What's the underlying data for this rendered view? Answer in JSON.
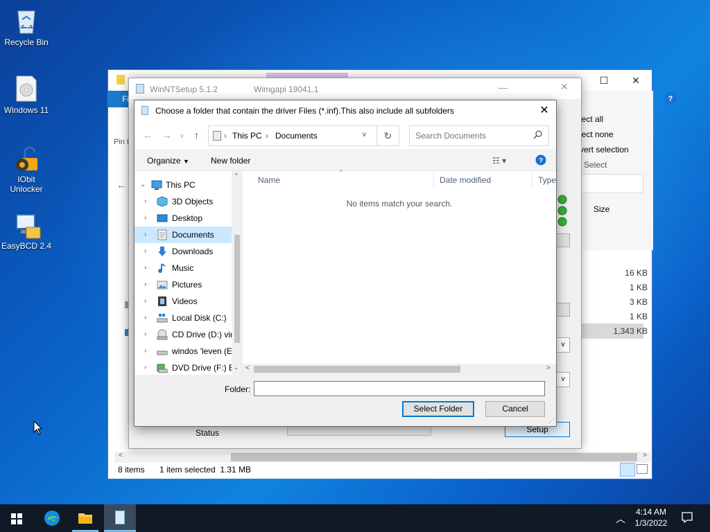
{
  "desktop": {
    "icons": [
      {
        "label": "Recycle Bin"
      },
      {
        "label": "Windows 11"
      },
      {
        "label": "IObit Unlocker"
      },
      {
        "label": "EasyBCD 2.4"
      }
    ]
  },
  "explorer": {
    "ribbon_tab": "Fi",
    "pin_text": "Pin t",
    "right_panel": {
      "select_all": "lect all",
      "select_none": "lect none",
      "invert_selection": "vert selection",
      "select_group": "Select"
    },
    "size_header": "Size",
    "sizes": [
      "16 KB",
      "1 KB",
      "3 KB",
      "1 KB",
      "1,343 KB"
    ],
    "status_items": "8 items",
    "status_selected": "1 item selected  1.31 MB"
  },
  "winntsetup": {
    "title": "WinNTSetup 5.1.2",
    "wimgapi": "Wimgapi 19041.1",
    "status_label": "Status",
    "setup_button": "Setup"
  },
  "dialog": {
    "title": "Choose a folder that contain the driver Files (*.inf).This also include all subfolders",
    "breadcrumb": [
      "This PC",
      "Documents"
    ],
    "search_placeholder": "Search Documents",
    "organize": "Organize",
    "new_folder": "New folder",
    "tree": [
      {
        "label": "This PC",
        "icon": "pc-icon"
      },
      {
        "label": "3D Objects",
        "icon": "cube-icon"
      },
      {
        "label": "Desktop",
        "icon": "desktop-folder-icon"
      },
      {
        "label": "Documents",
        "icon": "documents-icon"
      },
      {
        "label": "Downloads",
        "icon": "download-icon"
      },
      {
        "label": "Music",
        "icon": "music-icon"
      },
      {
        "label": "Pictures",
        "icon": "pictures-icon"
      },
      {
        "label": "Videos",
        "icon": "videos-icon"
      },
      {
        "label": "Local Disk (C:)",
        "icon": "local-disk-icon"
      },
      {
        "label": "CD Drive (D:) virt",
        "icon": "cd-drive-icon"
      },
      {
        "label": "windos 'leven (E",
        "icon": "drive-icon"
      },
      {
        "label": "DVD Drive (F:) ES",
        "icon": "dvd-drive-icon"
      }
    ],
    "columns": [
      "Name",
      "Date modified",
      "Type"
    ],
    "empty_message": "No items match your search.",
    "folder_label": "Folder:",
    "folder_value": "",
    "select_folder_button": "Select Folder",
    "cancel_button": "Cancel"
  },
  "taskbar": {
    "time": "4:14 AM",
    "date": "1/3/2022"
  }
}
